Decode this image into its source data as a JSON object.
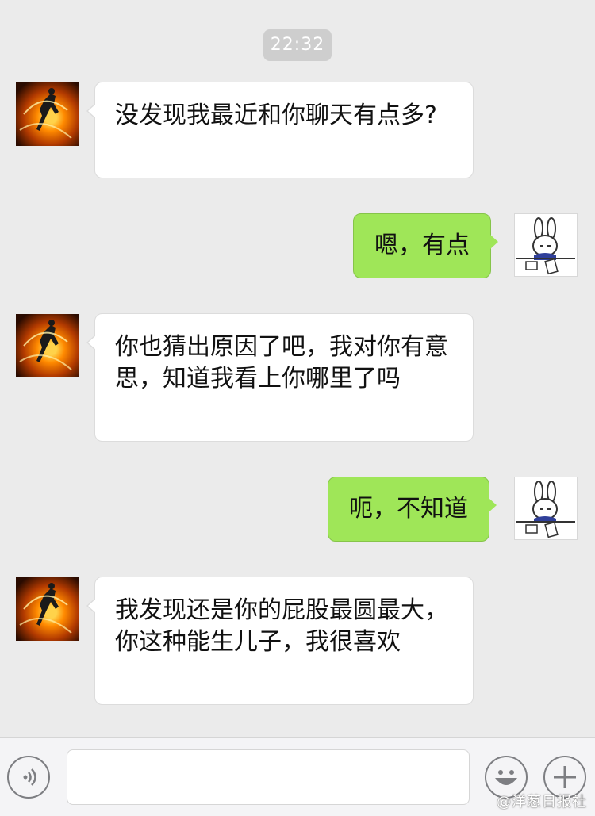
{
  "timestamp": "22:32",
  "messages": [
    {
      "side": "in",
      "text": "没发现我最近和你聊天有点多?"
    },
    {
      "side": "out",
      "text": "嗯，有点"
    },
    {
      "side": "in",
      "text": "你也猜出原因了吧，我对你有意思，知道我看上你哪里了吗"
    },
    {
      "side": "out",
      "text": "呃，不知道"
    },
    {
      "side": "in",
      "text": "我发现还是你的屁股最圆最大，你这种能生儿子，我很喜欢"
    }
  ],
  "toolbar": {
    "voice_icon": "voice-icon",
    "emoji_icon": "emoji-icon",
    "plus_icon": "plus-icon"
  },
  "watermark": "@洋葱日报社",
  "colors": {
    "background": "#ebebeb",
    "incoming_bubble": "#ffffff",
    "outgoing_bubble": "#9fe658"
  }
}
